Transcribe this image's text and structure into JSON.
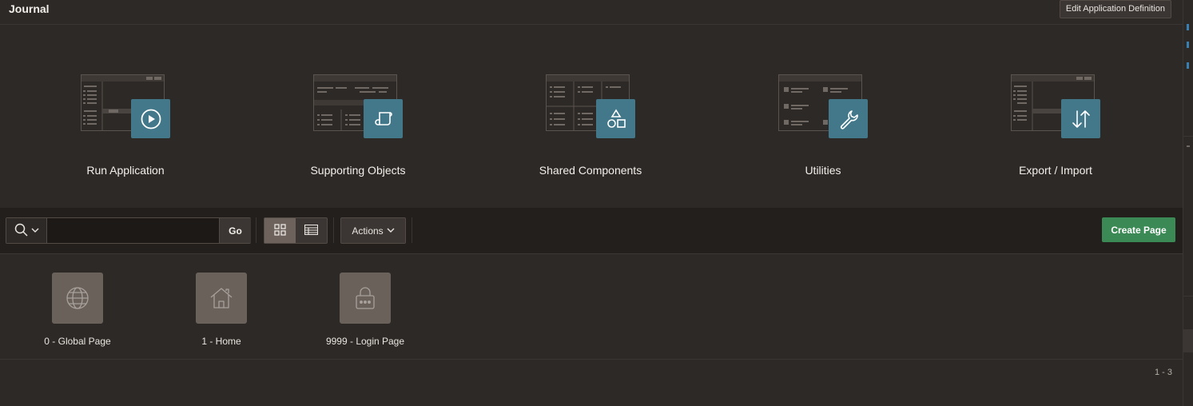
{
  "header": {
    "app_title": "Journal",
    "edit_button": "Edit Application Definition"
  },
  "tiles": [
    {
      "label": "Run Application",
      "icon": "play-icon"
    },
    {
      "label": "Supporting Objects",
      "icon": "scroll-icon"
    },
    {
      "label": "Shared Components",
      "icon": "shapes-icon"
    },
    {
      "label": "Utilities",
      "icon": "wrench-icon"
    },
    {
      "label": "Export / Import",
      "icon": "arrows-up-down-icon"
    }
  ],
  "toolbar": {
    "search_value": "",
    "go_label": "Go",
    "actions_label": "Actions",
    "create_page_label": "Create Page",
    "active_view": "icons"
  },
  "pages": [
    {
      "label": "0 - Global Page",
      "icon": "globe-icon"
    },
    {
      "label": "1 - Home",
      "icon": "home-icon"
    },
    {
      "label": "9999 - Login Page",
      "icon": "lock-icon"
    }
  ],
  "pagination": "1 - 3",
  "colors": {
    "background": "#2d2926",
    "toolbar": "#221f1d",
    "badge": "#42788a",
    "create_button": "#3b8a55",
    "page_icon": "#6a615b"
  }
}
